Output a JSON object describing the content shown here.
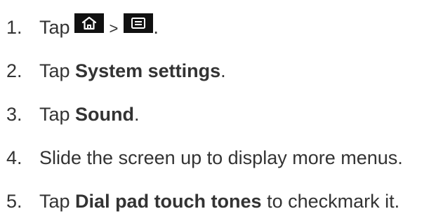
{
  "steps": [
    {
      "number": "1.",
      "text_before": "Tap",
      "icons": [
        "home-icon",
        "menu-icon"
      ],
      "separator": ">",
      "text_after": "."
    },
    {
      "number": "2.",
      "text_before": "Tap ",
      "bold": "System settings",
      "text_after": "."
    },
    {
      "number": "3.",
      "text_before": "Tap ",
      "bold": "Sound",
      "text_after": "."
    },
    {
      "number": "4.",
      "text": "Slide the screen up to display more menus."
    },
    {
      "number": "5.",
      "text_before": "Tap ",
      "bold": "Dial pad touch tones",
      "text_after": " to checkmark it."
    }
  ],
  "colors": {
    "text": "#333333",
    "key_background": "#111111",
    "key_icon": "#ffffff"
  }
}
